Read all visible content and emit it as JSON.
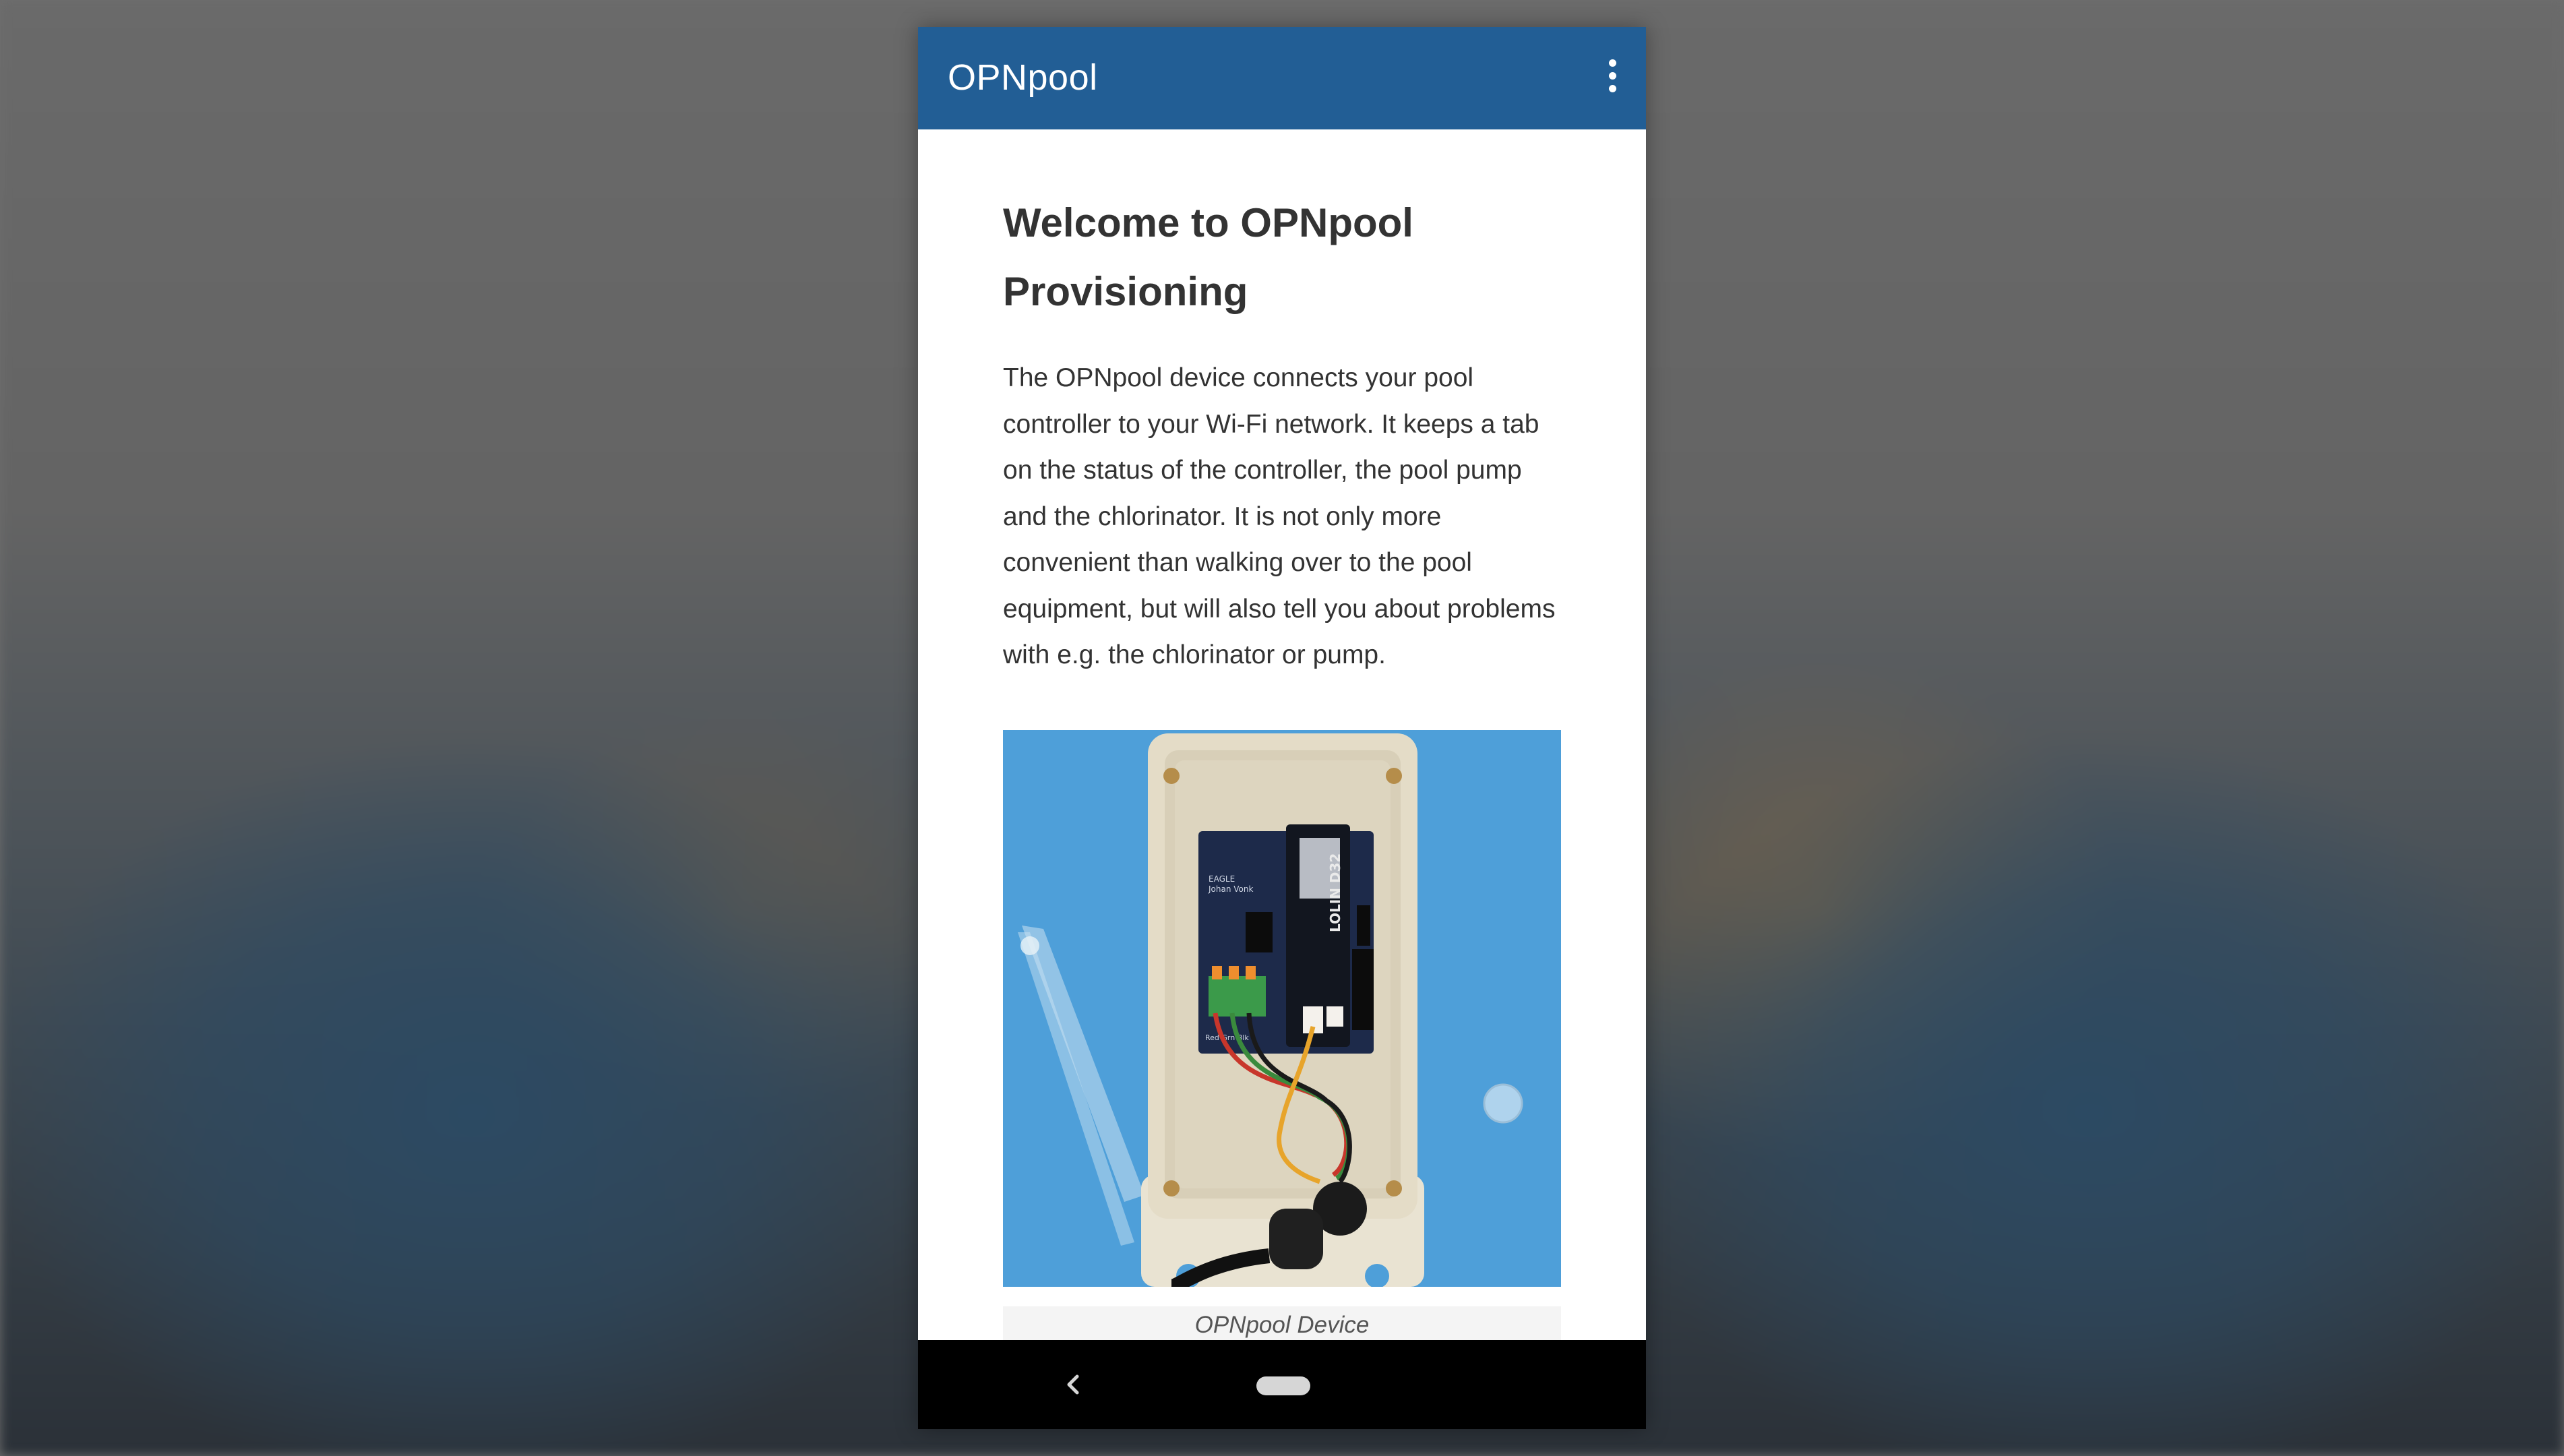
{
  "app_bar": {
    "title": "OPNpool",
    "menu_icon": "more-vert-icon",
    "background_color": "#225e95"
  },
  "main": {
    "heading": "Welcome to OPNpool Provisioning",
    "intro": "The OPNpool device connects your pool controller to your Wi-Fi network. It keeps a tab on the status of the controller, the pool pump and the chlorinator. It is not only more convenient than walking over to the pool equipment, but will also tell you about problems with e.g. the chlorinator or pump.",
    "figure": {
      "caption": "OPNpool Device",
      "board_text": {
        "line1": "EAGLE",
        "line2": "Johan Vonk",
        "module_label": "LOLIN D32",
        "terminal_label": "Red Grn Blk"
      }
    }
  },
  "system_nav": {
    "back_icon": "back-chevron-icon",
    "home_icon": "home-pill-icon"
  }
}
